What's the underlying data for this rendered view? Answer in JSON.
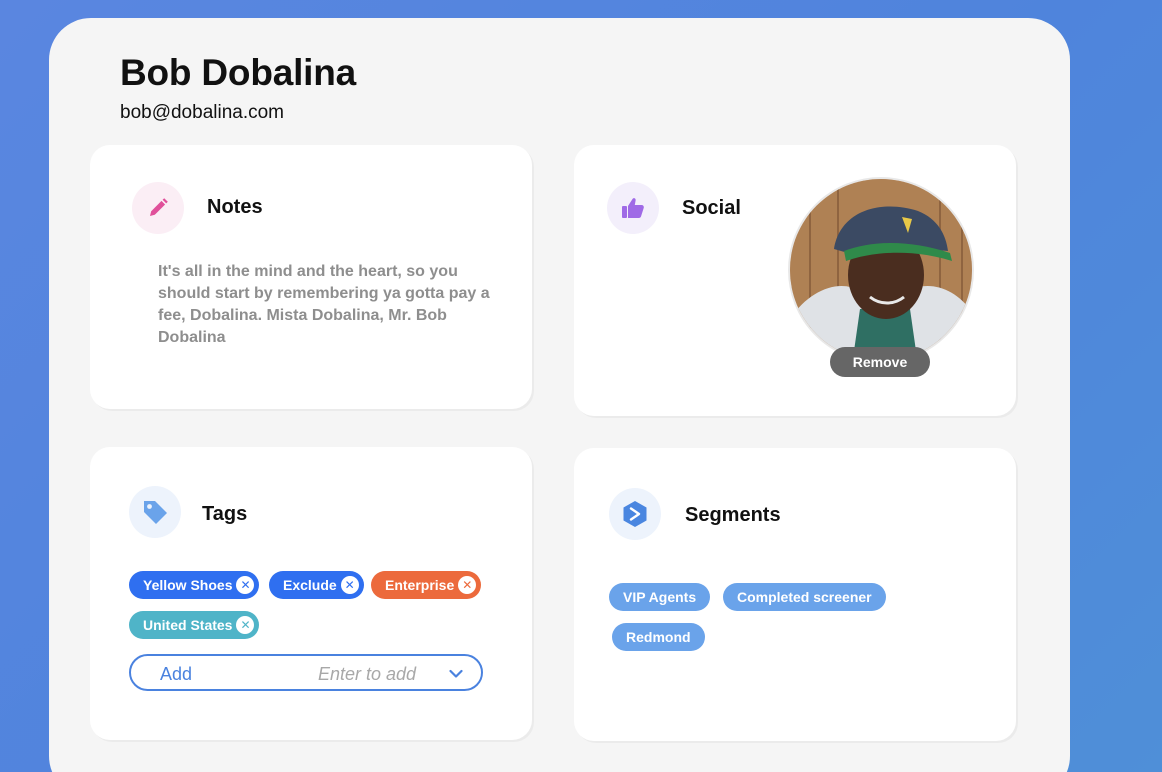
{
  "contact": {
    "name": "Bob Dobalina",
    "email": "bob@dobalina.com"
  },
  "notes": {
    "title": "Notes",
    "text": "It's all in the mind and the heart, so you should start by remembering ya gotta pay a fee, Dobalina. Mista Dobalina, Mr. Bob Dobalina",
    "icon": "pencil-icon"
  },
  "social": {
    "title": "Social",
    "icon": "thumbs-up-icon",
    "remove_label": "Remove"
  },
  "tags": {
    "title": "Tags",
    "icon": "tag-icon",
    "items": [
      {
        "label": "Yellow Shoes",
        "color": "#2f6ff0"
      },
      {
        "label": "Exclude",
        "color": "#2f6ff0"
      },
      {
        "label": "Enterprise",
        "color": "#ec6a3c"
      },
      {
        "label": "United States",
        "color": "#4fb4c8"
      }
    ],
    "add_label": "Add",
    "add_placeholder": "Enter to add"
  },
  "segments": {
    "title": "Segments",
    "icon": "segment-hexagon-icon",
    "items": [
      {
        "label": "VIP Agents"
      },
      {
        "label": "Completed screener"
      },
      {
        "label": "Redmond"
      }
    ]
  }
}
